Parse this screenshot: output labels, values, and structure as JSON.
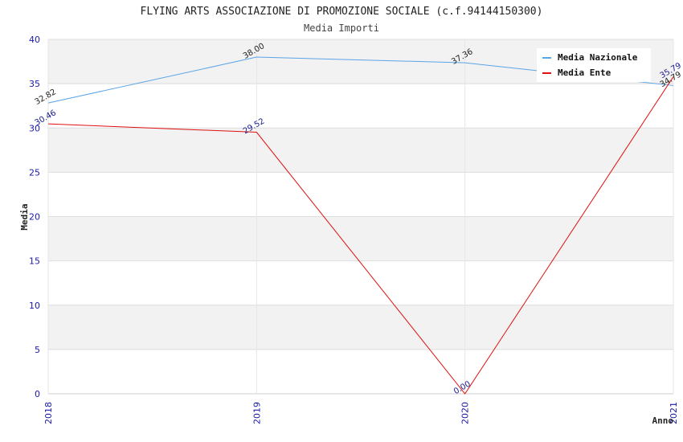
{
  "chart_data": {
    "type": "line",
    "title": "FLYING ARTS ASSOCIAZIONE DI PROMOZIONE SOCIALE (c.f.94144150300)",
    "subtitle": "Media Importi",
    "xlabel": "Anno",
    "ylabel": "Media",
    "x": [
      "2018",
      "2019",
      "2020",
      "2021"
    ],
    "ylim": [
      0,
      40
    ],
    "yticks": [
      0,
      5,
      10,
      15,
      20,
      25,
      30,
      35,
      40
    ],
    "legend_position": "top-right",
    "series": [
      {
        "name": "Media Nazionale",
        "color": "#5aa5e6",
        "label_color": "#222222",
        "values": [
          32.82,
          38.0,
          37.36,
          34.79
        ],
        "labels": [
          "32.82",
          "38.00",
          "37.36",
          "34.79"
        ]
      },
      {
        "name": "Media Ente",
        "color": "#e01010",
        "label_color": "#1a1a8c",
        "values": [
          30.46,
          29.52,
          0.0,
          35.79
        ],
        "labels": [
          "30.46",
          "29.52",
          "0.00",
          "35.79"
        ]
      }
    ]
  }
}
